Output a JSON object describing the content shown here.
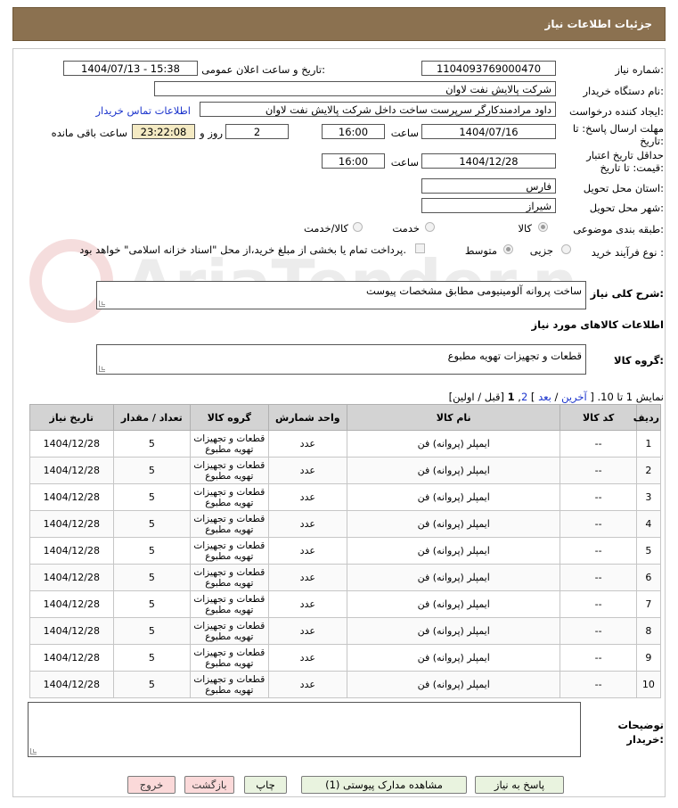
{
  "header": {
    "title": "جزئیات اطلاعات نیاز"
  },
  "form": {
    "need_number_label": "شماره نیاز:",
    "need_number": "1104093769000470",
    "announce_label": "تاریخ و ساعت اعلان عمومی:",
    "announce_value": "1404/07/13 - 15:38",
    "buyer_org_label": "نام دستگاه خریدار:",
    "buyer_org": "شرکت پالایش نفت لاوان",
    "creator_label": "ایجاد کننده درخواست:",
    "creator": "داود مرادمندکارگر سرپرست ساخت داخل شرکت پالایش نفت لاوان",
    "contact_link": "اطلاعات تماس خریدار",
    "reply_deadline_label_1": "مهلت ارسال پاسخ: تا",
    "reply_deadline_label_2": "تاریخ:",
    "reply_date": "1404/07/16",
    "time_label": "ساعت",
    "reply_time": "16:00",
    "days_value": "2",
    "days_label": "روز و",
    "remaining_time": "23:22:08",
    "remaining_label": "ساعت باقی مانده",
    "validity_label_1": "حداقل تاریخ اعتبار",
    "validity_label_2": "قیمت: تا تاریخ:",
    "validity_date": "1404/12/28",
    "validity_time": "16:00",
    "province_label": "استان محل تحویل:",
    "province": "فارس",
    "city_label": "شهر محل تحویل:",
    "city": "شیراز",
    "category_label": "طبقه بندی موضوعی:",
    "category_options": [
      "کالا",
      "خدمت",
      "کالا/خدمت"
    ],
    "process_label": "نوع فرآیند خرید :",
    "process_options": [
      "جزیی",
      "متوسط"
    ],
    "payment_note": "پرداخت تمام یا بخشی از مبلغ خرید،از محل \"اسناد خزانه اسلامی\" خواهد بود.",
    "description_label": "شرح کلی نیاز:",
    "description": "ساخت پروانه آلومینیومی مطابق مشخصات پیوست",
    "goods_info_title": "اطلاعات کالاهای مورد نیاز",
    "goods_group_label": "گروه کالا:",
    "goods_group": "قطعات و تجهیزات تهویه مطبوع"
  },
  "pagination": {
    "prefix": "نمایش 1 تا 10.",
    "bracket_open": "[",
    "last": "آخرین",
    "sep1": "/",
    "next": "بعد",
    "bracket_close": "]",
    "page2": "2",
    "comma": ",",
    "page1": "1",
    "rest": "[قبل / اولین]"
  },
  "table": {
    "headers": [
      "ردیف",
      "کد کالا",
      "نام کالا",
      "واحد شمارش",
      "گروه کالا",
      "تعداد / مقدار",
      "تاریخ نیاز"
    ],
    "rows": [
      [
        "1",
        "--",
        "ایمپلر (پروانه) فن",
        "عدد",
        "قطعات و تجهیزات تهویه مطبوع",
        "5",
        "1404/12/28"
      ],
      [
        "2",
        "--",
        "ایمپلر (پروانه) فن",
        "عدد",
        "قطعات و تجهیزات تهویه مطبوع",
        "5",
        "1404/12/28"
      ],
      [
        "3",
        "--",
        "ایمپلر (پروانه) فن",
        "عدد",
        "قطعات و تجهیزات تهویه مطبوع",
        "5",
        "1404/12/28"
      ],
      [
        "4",
        "--",
        "ایمپلر (پروانه) فن",
        "عدد",
        "قطعات و تجهیزات تهویه مطبوع",
        "5",
        "1404/12/28"
      ],
      [
        "5",
        "--",
        "ایمپلر (پروانه) فن",
        "عدد",
        "قطعات و تجهیزات تهویه مطبوع",
        "5",
        "1404/12/28"
      ],
      [
        "6",
        "--",
        "ایمپلر (پروانه) فن",
        "عدد",
        "قطعات و تجهیزات تهویه مطبوع",
        "5",
        "1404/12/28"
      ],
      [
        "7",
        "--",
        "ایمپلر (پروانه) فن",
        "عدد",
        "قطعات و تجهیزات تهویه مطبوع",
        "5",
        "1404/12/28"
      ],
      [
        "8",
        "--",
        "ایمپلر (پروانه) فن",
        "عدد",
        "قطعات و تجهیزات تهویه مطبوع",
        "5",
        "1404/12/28"
      ],
      [
        "9",
        "--",
        "ایمپلر (پروانه) فن",
        "عدد",
        "قطعات و تجهیزات تهویه مطبوع",
        "5",
        "1404/12/28"
      ],
      [
        "10",
        "--",
        "ایمپلر (پروانه) فن",
        "عدد",
        "قطعات و تجهیزات تهویه مطبوع",
        "5",
        "1404/12/28"
      ]
    ]
  },
  "buyer_notes_label_1": "توضیحات",
  "buyer_notes_label_2": "خریدار:",
  "buttons": {
    "reply": "پاسخ به نیاز",
    "attachments": "مشاهده مدارک پیوستی (1)",
    "print": "چاپ",
    "back": "بازگشت",
    "exit": "خروج"
  },
  "watermark": "AriaTender.neT"
}
